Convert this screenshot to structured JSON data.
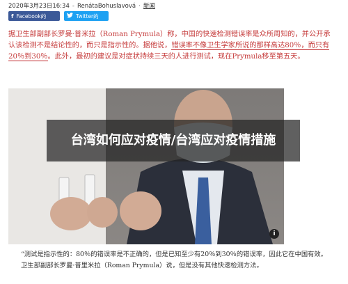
{
  "meta": {
    "datetime": "2020年3月23日16:34",
    "author": "RenátaBohuslavová",
    "category": "新闻"
  },
  "share": {
    "facebook_icon": "f",
    "facebook_label": "Facebook的",
    "twitter_icon": "twitter-bird-icon",
    "twitter_label": "Twitter的"
  },
  "article": {
    "para1_a": "据卫生部副部长罗曼·普米拉（Roman Prymula）称，中国的快速检测错误率是众所周知的，并公开承认该检测不是结论性的，而只是指示性的。据他说，",
    "para1_highlight": "错误率不像卫生学家所说的那样高达80％，而只有20％到30％",
    "para1_b": "。此外，最初的建议是对症状持续三天的人进行测试，现在Prymula移至第五天。",
    "overlay_title": "台湾如何应对疫情/台湾应对疫情措施",
    "photo_info": "i",
    "para2": "“测试是指示性的：80％的错误率是不正确的，但是已知至少有20％到30％的错误率，因此它在中国有效。卫生部副部长罗曼·普里米拉（Roman Prymula）说，但是没有其他快速检测方法。"
  },
  "colors": {
    "red_text": "#c53a3a",
    "facebook": "#3b5998",
    "twitter": "#1da1f2"
  }
}
